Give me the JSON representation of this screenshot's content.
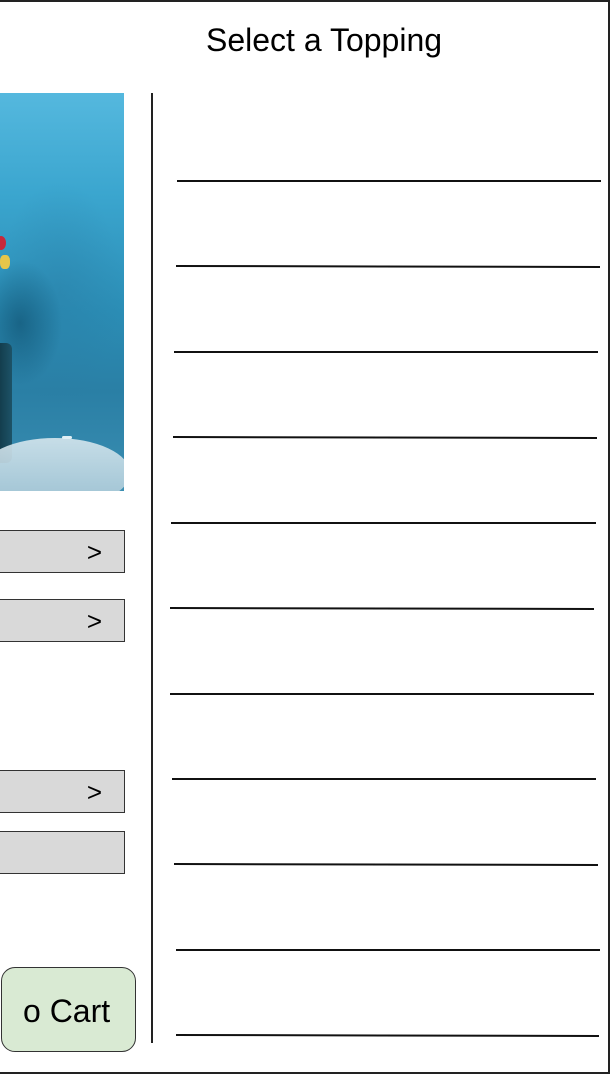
{
  "header": {
    "title": "Select a Topping"
  },
  "options": [
    {
      "chevron": ">"
    },
    {
      "chevron": ">"
    },
    {
      "chevron": ">"
    },
    {
      "chevron": ""
    }
  ],
  "cart": {
    "label": "o Cart"
  },
  "colors": {
    "button_fill": "#d9d9d9",
    "cart_fill": "#d9ead3",
    "photo_sky": "#3ba6cf"
  },
  "topping_slots": 11
}
